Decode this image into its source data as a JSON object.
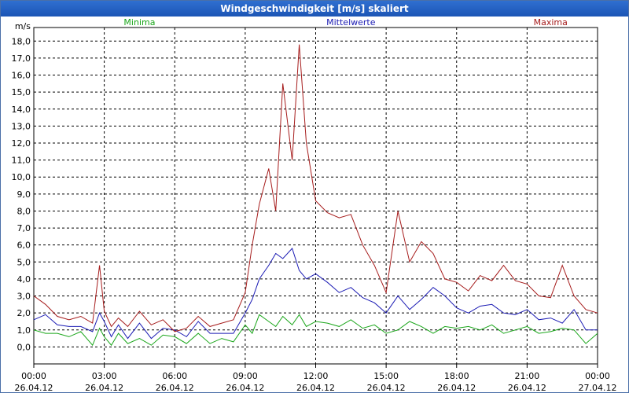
{
  "window": {
    "title": "Windgeschwindigkeit [m/s] skaliert"
  },
  "colors": {
    "minima": "#1aa61a",
    "mittelwerte": "#1c1cb4",
    "maxima": "#a61c1c",
    "grid": "#000000"
  },
  "chart_data": {
    "type": "line",
    "title": "Windgeschwindigkeit [m/s] skaliert",
    "ylabel": "m/s",
    "ylim": [
      -1,
      18.8
    ],
    "xlim": [
      0,
      24
    ],
    "x_tick_labels": [
      {
        "time": "00:00",
        "date": "26.04.12"
      },
      {
        "time": "03:00",
        "date": "26.04.12"
      },
      {
        "time": "06:00",
        "date": "26.04.12"
      },
      {
        "time": "09:00",
        "date": "26.04.12"
      },
      {
        "time": "12:00",
        "date": "26.04.12"
      },
      {
        "time": "15:00",
        "date": "26.04.12"
      },
      {
        "time": "18:00",
        "date": "26.04.12"
      },
      {
        "time": "21:00",
        "date": "26.04.12"
      },
      {
        "time": "00:00",
        "date": "27.04.12"
      }
    ],
    "y_tick_labels": [
      "0,0",
      "1,0",
      "2,0",
      "3,0",
      "4,0",
      "5,0",
      "6,0",
      "7,0",
      "8,0",
      "9,0",
      "10,0",
      "11,0",
      "12,0",
      "13,0",
      "14,0",
      "15,0",
      "16,0",
      "17,0",
      "18,0"
    ],
    "grid": true,
    "series": [
      {
        "name": "Minima",
        "color": "#1aa61a",
        "x": [
          0,
          0.5,
          1,
          1.5,
          2,
          2.5,
          2.8,
          3,
          3.3,
          3.6,
          4,
          4.5,
          5,
          5.5,
          6,
          6.5,
          7,
          7.5,
          8,
          8.5,
          9,
          9.3,
          9.6,
          10,
          10.3,
          10.6,
          11,
          11.3,
          11.6,
          12,
          12.5,
          13,
          13.5,
          14,
          14.5,
          15,
          15.5,
          16,
          16.5,
          17,
          17.5,
          18,
          18.5,
          19,
          19.5,
          20,
          20.5,
          21,
          21.5,
          22,
          22.5,
          23,
          23.5,
          24
        ],
        "y": [
          1.0,
          0.8,
          0.8,
          0.6,
          0.9,
          0.1,
          1.1,
          0.6,
          0.1,
          0.8,
          0.2,
          0.5,
          0.1,
          0.7,
          0.6,
          0.2,
          0.8,
          0.2,
          0.5,
          0.3,
          1.3,
          0.8,
          1.9,
          1.5,
          1.2,
          1.8,
          1.3,
          1.9,
          1.2,
          1.5,
          1.4,
          1.2,
          1.6,
          1.1,
          1.3,
          0.8,
          1.0,
          1.5,
          1.2,
          0.8,
          1.2,
          1.1,
          1.2,
          1.0,
          1.3,
          0.8,
          1.0,
          1.2,
          0.8,
          0.9,
          1.1,
          1.0,
          0.2,
          0.8
        ]
      },
      {
        "name": "Mittelwerte",
        "color": "#1c1cb4",
        "x": [
          0,
          0.5,
          1,
          1.5,
          2,
          2.5,
          2.8,
          3,
          3.3,
          3.6,
          4,
          4.5,
          5,
          5.5,
          6,
          6.5,
          7,
          7.5,
          8,
          8.5,
          9,
          9.3,
          9.6,
          10,
          10.3,
          10.6,
          11,
          11.3,
          11.6,
          12,
          12.5,
          13,
          13.5,
          14,
          14.5,
          15,
          15.5,
          16,
          16.5,
          17,
          17.5,
          18,
          18.5,
          19,
          19.5,
          20,
          20.5,
          21,
          21.5,
          22,
          22.5,
          23,
          23.5,
          24
        ],
        "y": [
          1.6,
          1.9,
          1.3,
          1.2,
          1.2,
          0.9,
          2.0,
          1.5,
          0.6,
          1.3,
          0.5,
          1.4,
          0.5,
          1.1,
          1.0,
          0.6,
          1.5,
          0.8,
          0.8,
          0.8,
          2.0,
          2.8,
          4.0,
          4.8,
          5.5,
          5.2,
          5.8,
          4.5,
          4.0,
          4.3,
          3.8,
          3.2,
          3.5,
          2.9,
          2.6,
          2.0,
          3.0,
          2.2,
          2.8,
          3.5,
          3.0,
          2.3,
          2.0,
          2.4,
          2.5,
          2.0,
          1.9,
          2.2,
          1.6,
          1.7,
          1.4,
          2.2,
          1.0,
          1.0
        ]
      },
      {
        "name": "Maxima",
        "color": "#a61c1c",
        "x": [
          0,
          0.5,
          1,
          1.5,
          2,
          2.5,
          2.8,
          3,
          3.3,
          3.6,
          4,
          4.5,
          5,
          5.5,
          6,
          6.5,
          7,
          7.5,
          8,
          8.5,
          9,
          9.3,
          9.6,
          10,
          10.3,
          10.6,
          11,
          11.3,
          11.6,
          12,
          12.5,
          13,
          13.5,
          14,
          14.5,
          15,
          15.5,
          16,
          16.5,
          17,
          17.5,
          18,
          18.5,
          19,
          19.5,
          20,
          20.5,
          21,
          21.5,
          22,
          22.5,
          23,
          23.5,
          24
        ],
        "y": [
          3.0,
          2.5,
          1.8,
          1.6,
          1.8,
          1.4,
          4.8,
          2.1,
          1.2,
          1.7,
          1.2,
          2.1,
          1.3,
          1.6,
          0.9,
          1.1,
          1.8,
          1.2,
          1.4,
          1.6,
          3.2,
          6.0,
          8.4,
          10.5,
          8.0,
          15.5,
          11.0,
          17.8,
          12.0,
          8.6,
          7.9,
          7.6,
          7.8,
          6.0,
          4.8,
          3.2,
          8.0,
          5.0,
          6.2,
          5.5,
          4.0,
          3.8,
          3.3,
          4.2,
          3.9,
          4.8,
          3.9,
          3.7,
          3.0,
          2.9,
          4.8,
          3.0,
          2.2,
          2.0
        ]
      }
    ]
  }
}
